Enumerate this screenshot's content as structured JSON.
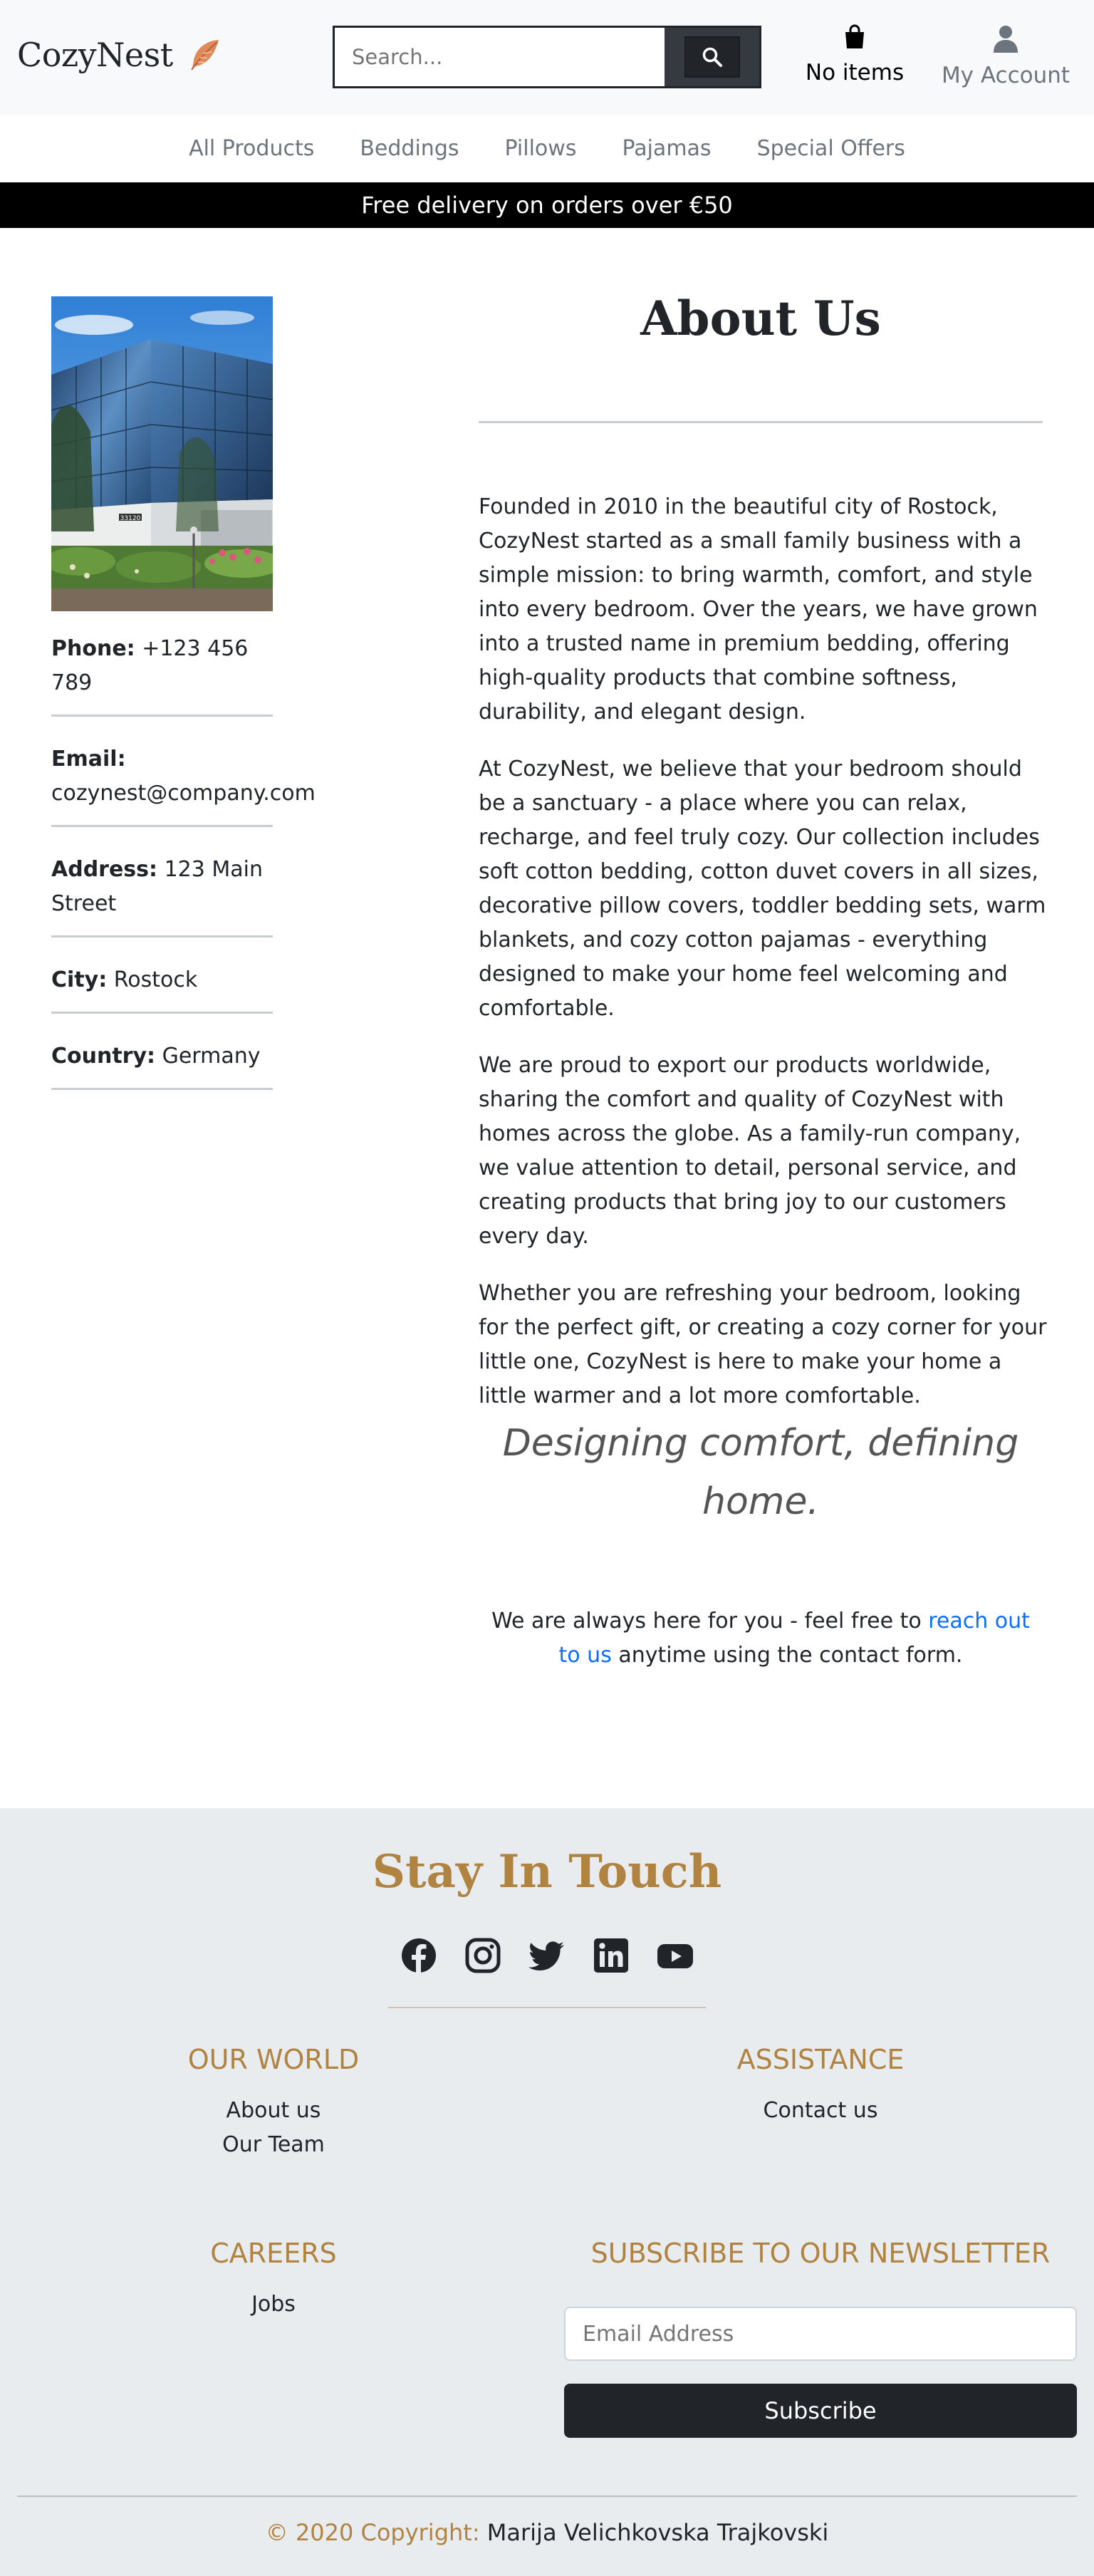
{
  "header": {
    "logo_text": "CozyNest",
    "search_placeholder": "Search...",
    "cart_label": "No items",
    "account_label": "My Account"
  },
  "nav": {
    "items": [
      "All Products",
      "Beddings",
      "Pillows",
      "Pajamas",
      "Special Offers"
    ]
  },
  "banner": {
    "text": "Free delivery on orders over €50"
  },
  "contact": {
    "phone_label": "Phone:",
    "phone": "+123 456 789",
    "email_label": "Email:",
    "email": "cozynest@company.com",
    "address_label": "Address:",
    "address": "123 Main Street",
    "city_label": "City:",
    "city": "Rostock",
    "country_label": "Country:",
    "country": "Germany"
  },
  "about": {
    "title": "About Us",
    "paragraphs": [
      "Founded in 2010 in the beautiful city of Rostock, CozyNest started as a small family business with a simple mission: to bring warmth, comfort, and style into every bedroom. Over the years, we have grown into a trusted name in premium bedding, offering high-quality products that combine softness, durability, and elegant design.",
      "At CozyNest, we believe that your bedroom should be a sanctuary - a place where you can relax, recharge, and feel truly cozy. Our collection includes soft cotton bedding, cotton duvet covers in all sizes, decorative pillow covers, toddler bedding sets, warm blankets, and cozy cotton pajamas - everything designed to make your home feel welcoming and comfortable.",
      "We are proud to export our products worldwide, sharing the comfort and quality of CozyNest with homes across the globe. As a family-run company, we value attention to detail, personal service, and creating products that bring joy to our customers every day.",
      "Whether you are refreshing your bedroom, looking for the perfect gift, or creating a cozy corner for your little one, CozyNest is here to make your home a little warmer and a lot more comfortable."
    ],
    "tagline": "Designing comfort, defining home.",
    "contact_prefix": "We are always here for you - feel free to ",
    "contact_link": "reach out to us",
    "contact_suffix": " anytime using the contact form.",
    "building_number": "33120"
  },
  "footer": {
    "heading": "Stay In Touch",
    "socials": [
      "facebook-icon",
      "instagram-icon",
      "twitter-icon",
      "linkedin-icon",
      "youtube-icon"
    ],
    "world_heading": "OUR WORLD",
    "world_links": [
      "About us",
      "Our Team"
    ],
    "assist_heading": "ASSISTANCE",
    "assist_links": [
      "Contact us"
    ],
    "careers_heading": "CAREERS",
    "careers_links": [
      "Jobs"
    ],
    "newsletter_heading": "SUBSCRIBE TO OUR NEWSLETTER",
    "email_placeholder": "Email Address",
    "subscribe_label": "Subscribe",
    "copyright_prefix": "© 2020 Copyright:",
    "copyright_name": "Marija Velichkovska Trajkovski"
  },
  "colors": {
    "accent": "#b08340",
    "link": "#0d6efd",
    "footer_bg": "#e9ecef",
    "header_bg": "#f8f9fa",
    "dark": "#212529"
  }
}
